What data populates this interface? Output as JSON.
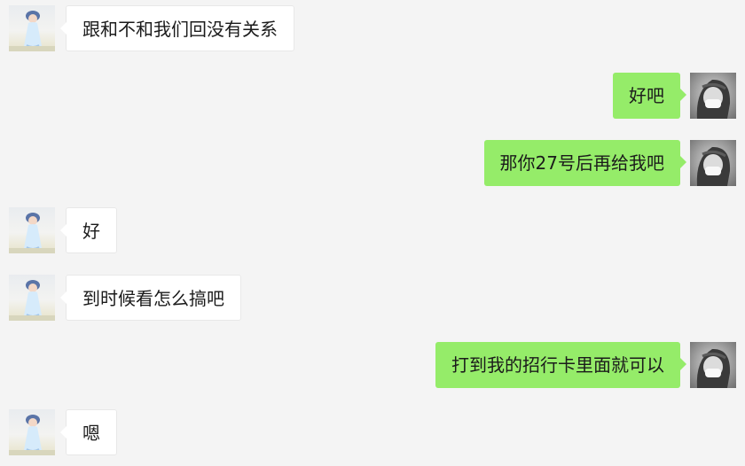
{
  "messages": [
    {
      "side": "left",
      "text": "跟和不和我们回没有关系"
    },
    {
      "side": "right",
      "text": "好吧"
    },
    {
      "side": "right",
      "text": "那你27号后再给我吧"
    },
    {
      "side": "left",
      "text": "好"
    },
    {
      "side": "left",
      "text": "到时候看怎么搞吧"
    },
    {
      "side": "right",
      "text": "打到我的招行卡里面就可以"
    },
    {
      "side": "left",
      "text": "嗯"
    }
  ],
  "colors": {
    "background": "#f4f4f4",
    "incoming_bubble": "#ffffff",
    "outgoing_bubble": "#95ec69",
    "text": "#1b1b1b"
  },
  "icons": {
    "left_avatar": "girl-in-white-dress-avatar",
    "right_avatar": "masked-girl-avatar"
  }
}
